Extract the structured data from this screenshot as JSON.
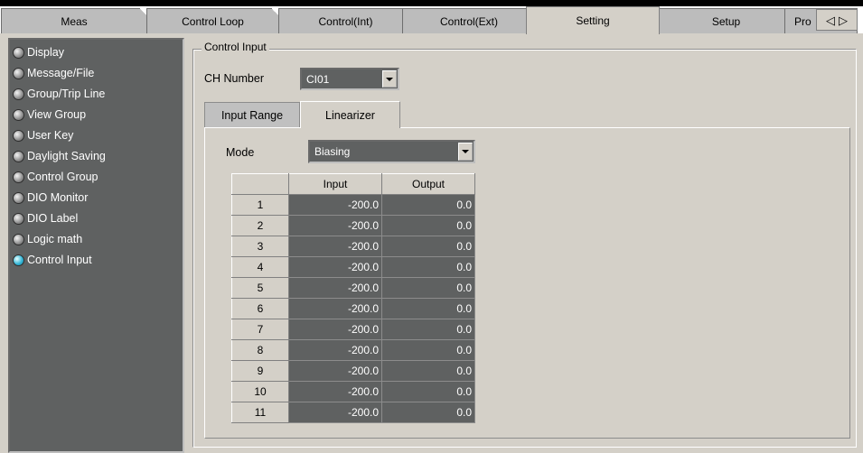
{
  "main_tabs": [
    {
      "label": "Meas"
    },
    {
      "label": "Control Loop"
    },
    {
      "label": "Control(Int)"
    },
    {
      "label": "Control(Ext)"
    },
    {
      "label": "Setting",
      "active": true
    },
    {
      "label": "Setup"
    },
    {
      "label": "Pro"
    }
  ],
  "tab_scroll": {
    "left": "◁",
    "right": "▷"
  },
  "sidebar": {
    "items": [
      {
        "label": "Display"
      },
      {
        "label": "Message/File"
      },
      {
        "label": "Group/Trip Line"
      },
      {
        "label": "View Group"
      },
      {
        "label": "User Key"
      },
      {
        "label": "Daylight Saving"
      },
      {
        "label": "Control Group"
      },
      {
        "label": "DIO Monitor"
      },
      {
        "label": "DIO Label"
      },
      {
        "label": "Logic math"
      },
      {
        "label": "Control Input",
        "selected": true
      }
    ]
  },
  "control_input": {
    "group_title": "Control Input",
    "ch_number_label": "CH Number",
    "ch_number_value": "CI01",
    "tabs": [
      {
        "label": "Input Range"
      },
      {
        "label": "Linearizer",
        "active": true
      }
    ],
    "mode_label": "Mode",
    "mode_value": "Biasing",
    "table": {
      "headers": [
        "",
        "Input",
        "Output"
      ],
      "rows": [
        {
          "n": "1",
          "input": "-200.0",
          "output": "0.0"
        },
        {
          "n": "2",
          "input": "-200.0",
          "output": "0.0"
        },
        {
          "n": "3",
          "input": "-200.0",
          "output": "0.0"
        },
        {
          "n": "4",
          "input": "-200.0",
          "output": "0.0"
        },
        {
          "n": "5",
          "input": "-200.0",
          "output": "0.0"
        },
        {
          "n": "6",
          "input": "-200.0",
          "output": "0.0"
        },
        {
          "n": "7",
          "input": "-200.0",
          "output": "0.0"
        },
        {
          "n": "8",
          "input": "-200.0",
          "output": "0.0"
        },
        {
          "n": "9",
          "input": "-200.0",
          "output": "0.0"
        },
        {
          "n": "10",
          "input": "-200.0",
          "output": "0.0"
        },
        {
          "n": "11",
          "input": "-200.0",
          "output": "0.0"
        }
      ]
    }
  },
  "colors": {
    "panel_bg": "#d4d0c8",
    "dark_field": "#5f6161",
    "selected_dot": "#38b8d8"
  }
}
